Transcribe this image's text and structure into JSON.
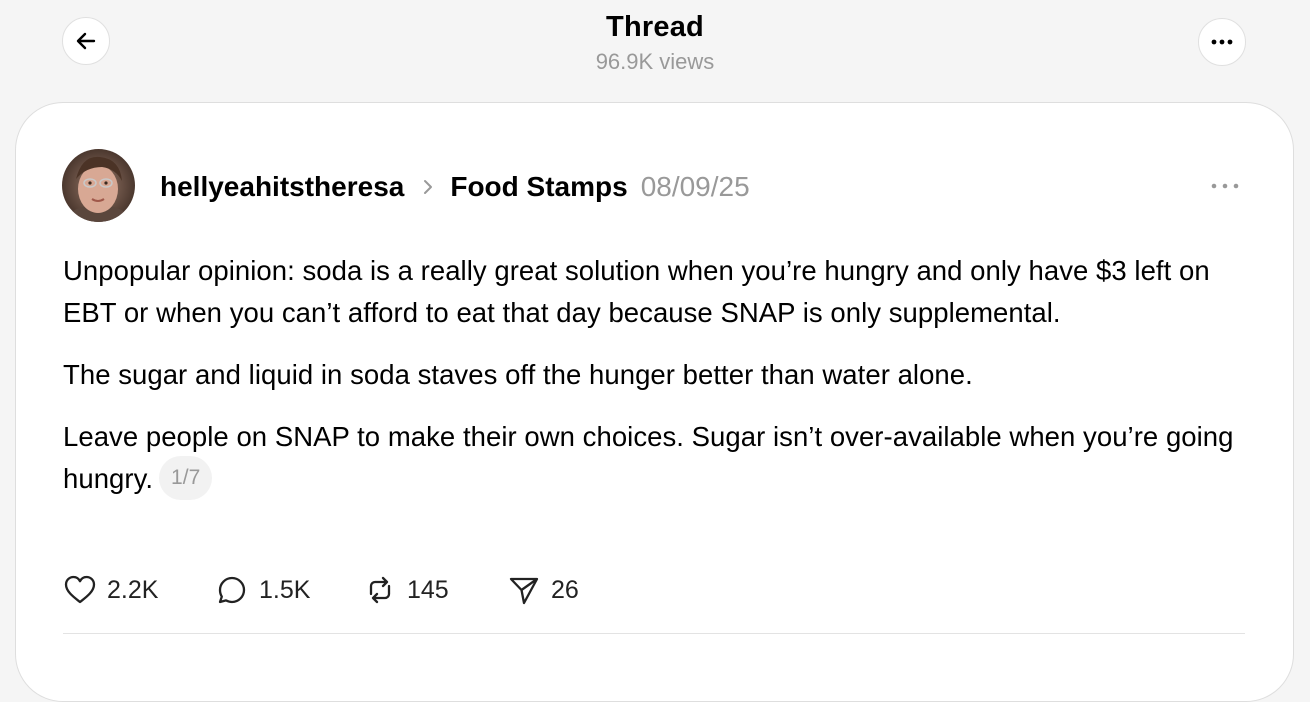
{
  "header": {
    "title": "Thread",
    "views": "96.9K views",
    "back_icon": "arrow-left-icon",
    "more_icon": "more-horizontal-icon"
  },
  "post": {
    "username": "hellyeahitstheresa",
    "community": "Food Stamps",
    "date": "08/09/25",
    "paragraphs": [
      "Unpopular opinion: soda is a really great solution when you’re hungry and only have $3 left on EBT or when you can’t afford to eat that day because SNAP is only supplemental.",
      "The sugar and liquid in soda staves off the hunger better than water alone.",
      "Leave people on SNAP to make their own choices. Sugar isn’t over-available when you’re going hungry."
    ],
    "pager": "1/7",
    "actions": {
      "likes": "2.2K",
      "replies": "1.5K",
      "reposts": "145",
      "shares": "26"
    }
  },
  "colors": {
    "background": "#f5f5f5",
    "card": "#ffffff",
    "muted_text": "#999999",
    "text": "#000000"
  }
}
